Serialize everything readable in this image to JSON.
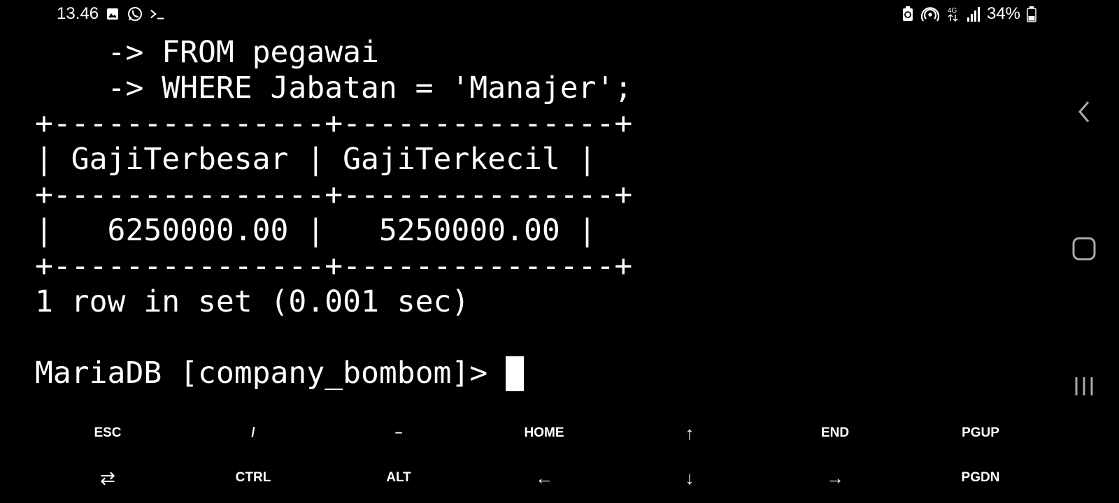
{
  "status_bar": {
    "time": "13.46",
    "left_icons": [
      "image-icon",
      "whatsapp-icon",
      "terminal-icon"
    ],
    "right_icons": [
      "battery-saver-icon",
      "hotspot-icon",
      "4g-data-icon",
      "signal-icon"
    ],
    "battery_percent": "34%"
  },
  "terminal": {
    "lines": [
      "    -> FROM pegawai",
      "    -> WHERE Jabatan = 'Manajer';",
      "+---------------+---------------+",
      "| GajiTerbesar | GajiTerkecil |",
      "+---------------+---------------+",
      "|   6250000.00 |   5250000.00 |",
      "+---------------+---------------+",
      "1 row in set (0.001 sec)",
      ""
    ],
    "prompt": "MariaDB [company_bombom]> "
  },
  "result_table": {
    "columns": [
      "GajiTerbesar",
      "GajiTerkecil"
    ],
    "rows": [
      [
        "6250000.00",
        "5250000.00"
      ]
    ]
  },
  "extra_keys": {
    "row1": [
      "ESC",
      "/",
      "–",
      "HOME",
      "↑",
      "END",
      "PGUP"
    ],
    "row2": [
      "⇄",
      "CTRL",
      "ALT",
      "←",
      "↓",
      "→",
      "PGDN"
    ]
  },
  "nav": {
    "buttons": [
      "back-icon",
      "home-icon",
      "recents-icon"
    ]
  },
  "colors": {
    "background": "#000000",
    "foreground": "#ffffff"
  }
}
